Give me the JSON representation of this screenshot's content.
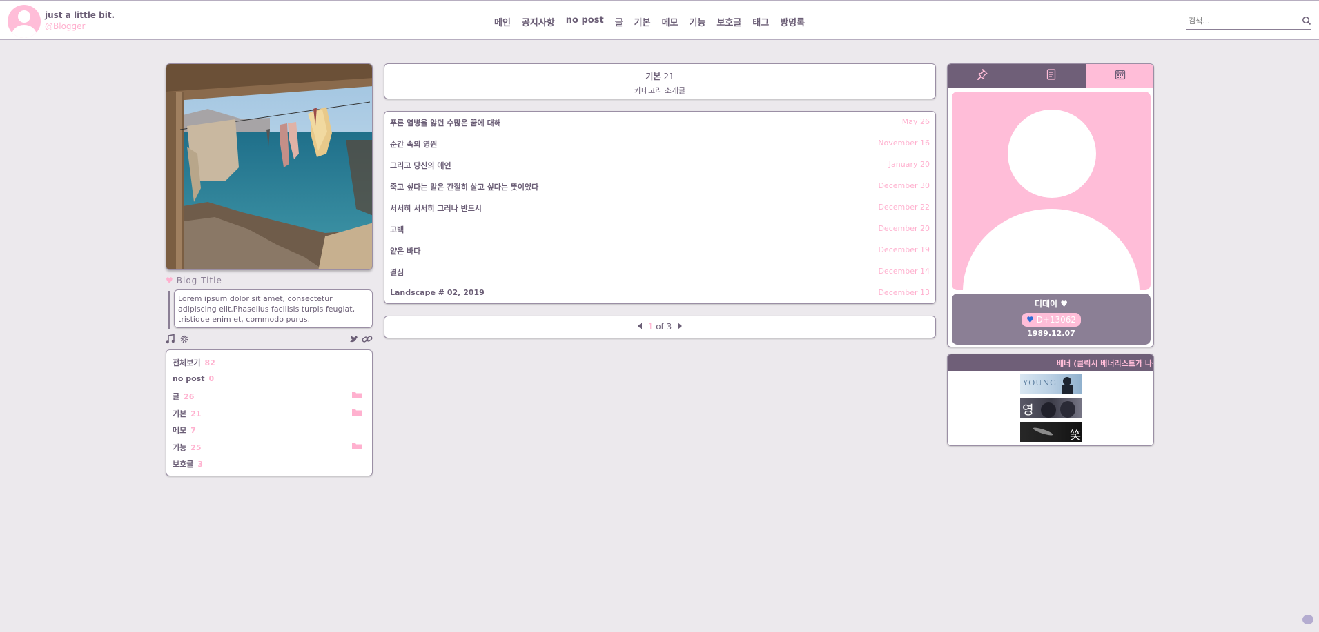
{
  "header": {
    "blog_name": "just a little bit.",
    "blog_id": "@Blogger",
    "nav": [
      "메인",
      "공지사항",
      "no post",
      "글",
      "기본",
      "메모",
      "기능",
      "보호글",
      "태그",
      "방명록"
    ],
    "search_placeholder": "검색..."
  },
  "left": {
    "blog_title": "Blog Title",
    "description": "Lorem ipsum dolor sit amet, consectetur adipiscing elit.Phasellus facilisis turpis feugiat, tristique enim et, commodo purus.",
    "categories": [
      {
        "label": "전체보기",
        "count": "82",
        "folder": false
      },
      {
        "label": "no post",
        "count": "0",
        "folder": false
      },
      {
        "label": "글",
        "count": "26",
        "folder": true
      },
      {
        "label": "기본",
        "count": "21",
        "folder": true
      },
      {
        "label": "메모",
        "count": "7",
        "folder": false
      },
      {
        "label": "기능",
        "count": "25",
        "folder": true
      },
      {
        "label": "보호글",
        "count": "3",
        "folder": false
      }
    ],
    "icons": [
      "music-icon",
      "gear-icon",
      "twitter-icon",
      "link-icon"
    ]
  },
  "middle": {
    "category_name": "기본",
    "category_count": "21",
    "category_desc": "카테고리 소개글",
    "posts": [
      {
        "title": "푸른 열병을 앓던 수많은 꿈에 대해",
        "date": "May 26"
      },
      {
        "title": "순간 속의 영원",
        "date": "November 16"
      },
      {
        "title": "그리고 당신의 애인",
        "date": "January 20"
      },
      {
        "title": "죽고 싶다는 말은 간절히 살고 싶다는 뜻이었다",
        "date": "December 30"
      },
      {
        "title": "서서히 서서히 그러나 반드시",
        "date": "December 22"
      },
      {
        "title": "고백",
        "date": "December 20"
      },
      {
        "title": "얕은 바다",
        "date": "December 19"
      },
      {
        "title": "결심",
        "date": "December 14"
      },
      {
        "title": "Landscape # 02, 2019",
        "date": "December 13"
      }
    ],
    "pager": {
      "current": "1",
      "of": "of",
      "total": "3"
    }
  },
  "right": {
    "tabs": [
      "pin-icon",
      "document-icon",
      "calendar-icon"
    ],
    "dday_name": "디데이",
    "dday_value": "D+13062",
    "dday_date": "1989.12.07",
    "banner_title": "배너 (클릭시 배너리스트가 나옵니다)",
    "banners": [
      {
        "text": "YOUNG"
      },
      {
        "text": "영"
      },
      {
        "text": "笑"
      }
    ]
  },
  "colors": {
    "accent_pink": "#ffb1cf",
    "purple_dark": "#6f5f78",
    "text": "#6b5e76",
    "background": "#ece9ed"
  }
}
